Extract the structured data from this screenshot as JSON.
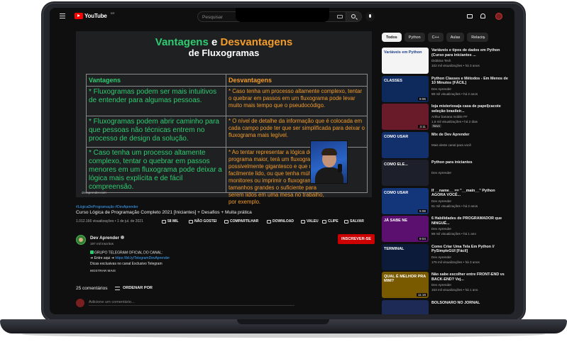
{
  "topbar": {
    "logo_text": "YouTube",
    "country": "BR",
    "search_placeholder": "Pesquisar"
  },
  "video": {
    "slide": {
      "title_word1": "Vantagens",
      "title_connector": "e",
      "title_word2": "Desvantagens",
      "title_line2": "de Fluxogramas",
      "col_left_header": "Vantagens",
      "col_right_header": "Desvantagens",
      "advantages": [
        "* Fluxogramas podem ser mais intuitivos de entender para algumas pessoas.",
        "* Fluxogramas podem abrir caminho para que pessoas não técnicas entrem no processo de design da solução.",
        "* Caso tenha um processo altamente complexo, tentar o quebrar em passos menores em um fluxograma pode deixar a lógica mais explícita e de fácil compreensão."
      ],
      "disadvantages": [
        "* Caso tenha um processo altamente complexo, tentar o quebrar em passos em um fluxograma pode levar muito mais tempo que o pseudocódigo.",
        "* O nível de detalhe da informação que é colocada em cada campo pode ter que ser simplificada para deixar o fluxograma mais legível.",
        "* Ao tentar representar a lógica de um programa maior, terá um fluxograma possivelmente gigantesco e que não é facilmente lido, ou que tenha múltiplos monitores ou imprimir o fluxograma em tamanhos grandes o suficiente para serem lidos em uma mesa no trabalho, por exemplo."
      ],
      "watermark": "devaprender.com"
    },
    "hashtags": "#LógicaDeProgramação #DevAprender",
    "title": "Curso Lógica de Programação Completo 2021 [Iniciantes] + Desafios + Muita prática",
    "meta": "1.012.166 visualizações • 1 de jul. de 2021",
    "actions": {
      "likes": "58 MIL",
      "dislike": "NÃO GOSTEI",
      "share": "COMPARTILHAR",
      "download": "DOWNLOAD",
      "thanks": "VALEU",
      "clip": "CLIPE",
      "save": "SALVAR"
    }
  },
  "channel": {
    "name": "Dev Aprender",
    "subscribers": "197 mil inscritos",
    "subscribe_label": "INSCREVER-SE"
  },
  "description": {
    "line1": "GRUPO TELEGRAM OFICIAL DO CANAL:",
    "line2_prefix": "➜ Entre aqui ➜ ",
    "line2_link": "https://bit.ly/TelegramDevAprender",
    "line3": "Dicas exclusivas no canal Exclusivo Telegram",
    "show_more": "MOSTRAR MAIS"
  },
  "comments": {
    "count": "25 comentários",
    "sort_label": "ORDENAR POR",
    "input_placeholder": "Adicione um comentário..."
  },
  "sidebar": {
    "chips": [
      "Todos",
      "Python",
      "C++",
      "Aulas",
      "Relacio"
    ],
    "recommendations": [
      {
        "title": "Variáveis e tipos de dados em Python (Curso para iniciantes ...",
        "channel": "Didática Tech",
        "meta": "102 mil visualizações • há 3 anos",
        "duration": "",
        "badge": "",
        "thumb_text": "Variáveis em Python",
        "thumb_color": "#f4f4f4",
        "thumb_text_color": "#1a3f8a"
      },
      {
        "title": "Python Classes e Métodos - Em Menos de 10 Minutos [FÁCIL]",
        "channel": "Dev Aprender",
        "meta": "88 mil visualizações • há 2 anos",
        "duration": "9:06",
        "badge": "",
        "thumb_text": "CLASSES",
        "thumb_color": "#0e2a5c",
        "thumb_text_color": "#ffffff"
      },
      {
        "title": "loja misteriosa|a casa de papel|cacote seleção brasileir...",
        "channel": "Arthur banana mobile FF",
        "meta": "1,6 mil visualizações • há 2 dias",
        "duration": "3:11",
        "badge": "Novo",
        "thumb_text": "",
        "thumb_color": "#6a1b2a",
        "thumb_text_color": "#ffffff"
      },
      {
        "title": "Mix de Dev Aprender",
        "channel": "Mais deste canal para você",
        "meta": "",
        "duration": "",
        "badge": "",
        "thumb_text": "COMO USAR",
        "thumb_color": "#12306b",
        "thumb_text_color": "#ffffff"
      },
      {
        "title": "Python para iniciantes",
        "channel": "Dev Aprender",
        "meta": "",
        "duration": "",
        "badge": "",
        "thumb_text": "COMO ELE...",
        "thumb_color": "#1d1f2a",
        "thumb_text_color": "#ffffff"
      },
      {
        "title": "If __name__ == \"__main__\" Python AGORA VOCÊ...",
        "channel": "Dev Aprender",
        "meta": "61 mil visualizações • há 2 anos",
        "duration": "5:08",
        "badge": "",
        "thumb_text": "COMO USAR",
        "thumb_color": "#13357a",
        "thumb_text_color": "#ffffff"
      },
      {
        "title": "6 Habilidades de PROGRAMADOR que NINGUÉ...",
        "channel": "Dev Aprender",
        "meta": "88 mil visualizações • há 1 ano",
        "duration": "9:04",
        "badge": "",
        "thumb_text": "JÁ SABE NE",
        "thumb_color": "#5b0f6e",
        "thumb_text_color": "#ffffff"
      },
      {
        "title": "Como Criar Uma Tela Em Python // PySimpleGUI [Fácil]",
        "channel": "Dev Aprender",
        "meta": "175 mil visualizações • há 3 anos",
        "duration": "",
        "badge": "",
        "thumb_text": "TERMINAL",
        "thumb_color": "#0c1b3a",
        "thumb_text_color": "#ffffff"
      },
      {
        "title": "Não sabe escolher entre FRONT-END vs BACK-END? Vej...",
        "channel": "Dev Aprender",
        "meta": "153 mil visualizações • há 1 ano",
        "duration": "11:16",
        "badge": "",
        "thumb_text": "QUAL É MELHOR PRA MIM?",
        "thumb_color": "#7a5a00",
        "thumb_text_color": "#ffffff"
      },
      {
        "title": "BOLSONARO NO JORNAL",
        "channel": "",
        "meta": "",
        "duration": "",
        "badge": "",
        "thumb_text": "",
        "thumb_color": "#1c2a55",
        "thumb_text_color": "#ffffff"
      }
    ]
  }
}
